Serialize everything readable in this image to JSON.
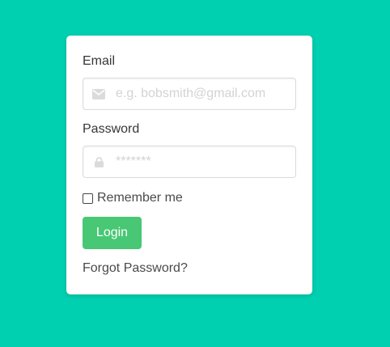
{
  "login_form": {
    "email_label": "Email",
    "email_placeholder": "e.g. bobsmith@gmail.com",
    "email_icon": "envelope-icon",
    "password_label": "Password",
    "password_placeholder": "*******",
    "password_icon": "lock-icon",
    "remember_label": "Remember me",
    "remember_checked": false,
    "login_button_label": "Login",
    "forgot_link_label": "Forgot Password?"
  },
  "colors": {
    "background": "#00cfb0",
    "card": "#ffffff",
    "button": "#48c774",
    "icon": "#dbdbdb"
  }
}
